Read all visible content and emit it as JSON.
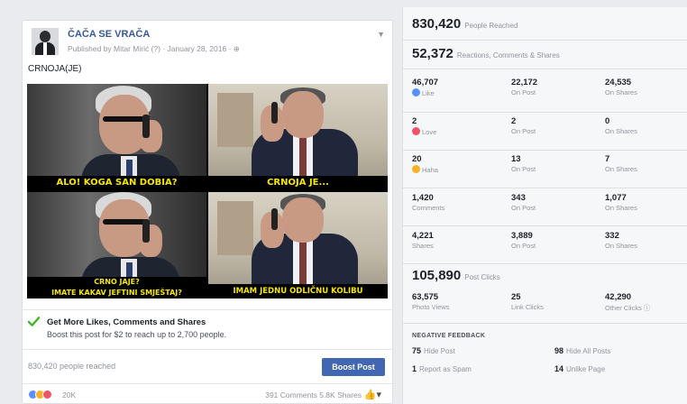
{
  "post": {
    "page_name": "ČAČA SE VRAČA",
    "published_by": "Published by Mitar Mirić (?) · January 28, 2016 · ⊕",
    "text": "CRNOJA(JE)",
    "captions": {
      "top_left": "ALO! KOGA SAN DOBIA?",
      "top_right": "CRNOJA JE...",
      "bottom_left_line1": "CRNO JAJE?",
      "bottom_left_line2": "IMATE KAKAV JEFTINI SMJEŠTAJ?",
      "bottom_right": "IMAM JEDNU ODLIČNU KOLIBU"
    },
    "promo_title": "Get More Likes, Comments and Shares",
    "promo_text": "Boost this post for $2 to reach up to 2,700 people.",
    "reach_text": "830,420 people reached",
    "boost_label": "Boost Post",
    "reaction_count": "20K",
    "comments_shares": "391 Comments  5.8K Shares"
  },
  "insights": {
    "people_reached": {
      "value": "830,420",
      "label": "People Reached"
    },
    "engagement": {
      "value": "52,372",
      "label": "Reactions, Comments & Shares"
    },
    "rows": [
      {
        "icon": "like",
        "total": "46,707",
        "total_label": "Like",
        "on_post": "22,172",
        "on_post_label": "On Post",
        "on_shares": "24,535",
        "on_shares_label": "On Shares"
      },
      {
        "icon": "love",
        "total": "2",
        "total_label": "Love",
        "on_post": "2",
        "on_post_label": "On Post",
        "on_shares": "0",
        "on_shares_label": "On Shares"
      },
      {
        "icon": "haha",
        "total": "20",
        "total_label": "Haha",
        "on_post": "13",
        "on_post_label": "On Post",
        "on_shares": "7",
        "on_shares_label": "On Shares"
      },
      {
        "icon": "",
        "total": "1,420",
        "total_label": "Comments",
        "on_post": "343",
        "on_post_label": "On Post",
        "on_shares": "1,077",
        "on_shares_label": "On Shares"
      },
      {
        "icon": "",
        "total": "4,221",
        "total_label": "Shares",
        "on_post": "3,889",
        "on_post_label": "On Post",
        "on_shares": "332",
        "on_shares_label": "On Shares"
      }
    ],
    "post_clicks": {
      "value": "105,890",
      "label": "Post Clicks"
    },
    "clicks": [
      {
        "value": "63,575",
        "label": "Photo Views"
      },
      {
        "value": "25",
        "label": "Link Clicks"
      },
      {
        "value": "42,290",
        "label": "Other Clicks ⓘ"
      }
    ],
    "negative_feedback": {
      "title": "NEGATIVE FEEDBACK",
      "hide_post": {
        "value": "75",
        "label": "Hide Post"
      },
      "hide_all": {
        "value": "98",
        "label": "Hide All Posts"
      },
      "report_spam": {
        "value": "1",
        "label": "Report as Spam"
      },
      "unlike_page": {
        "value": "14",
        "label": "Unlike Page"
      }
    }
  },
  "colors": {
    "link": "#365899",
    "boost": "#4267b2",
    "like": "#5890ff",
    "love": "#f25268",
    "haha": "#f7b125",
    "check": "#42b72a",
    "caption": "#f6e600"
  }
}
